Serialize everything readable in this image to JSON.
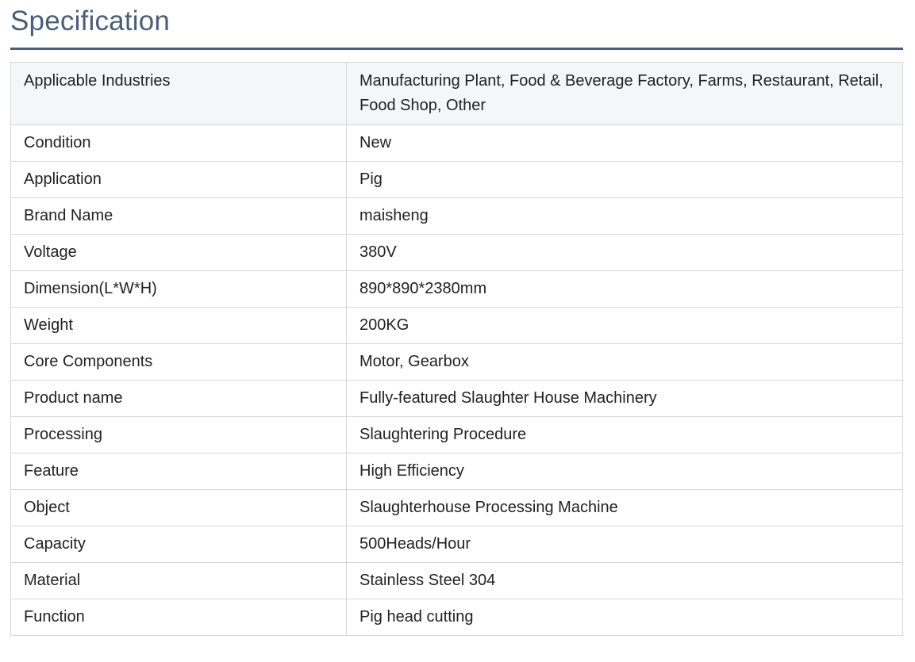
{
  "heading": "Specification",
  "specs": [
    {
      "label": "Applicable Industries",
      "value": "Manufacturing Plant, Food & Beverage Factory, Farms, Restaurant, Retail, Food Shop, Other"
    },
    {
      "label": "Condition",
      "value": "New"
    },
    {
      "label": "Application",
      "value": "Pig"
    },
    {
      "label": "Brand Name",
      "value": "maisheng"
    },
    {
      "label": "Voltage",
      "value": "380V"
    },
    {
      "label": "Dimension(L*W*H)",
      "value": "890*890*2380mm"
    },
    {
      "label": "Weight",
      "value": "200KG"
    },
    {
      "label": "Core Components",
      "value": "Motor, Gearbox"
    },
    {
      "label": "Product name",
      "value": "Fully-featured Slaughter House Machinery"
    },
    {
      "label": "Processing",
      "value": "Slaughtering Procedure"
    },
    {
      "label": "Feature",
      "value": "High Efficiency"
    },
    {
      "label": "Object",
      "value": "Slaughterhouse Processing Machine"
    },
    {
      "label": "Capacity",
      "value": "500Heads/Hour"
    },
    {
      "label": "Material",
      "value": "Stainless Steel 304"
    },
    {
      "label": "Function",
      "value": "Pig head cutting"
    }
  ]
}
